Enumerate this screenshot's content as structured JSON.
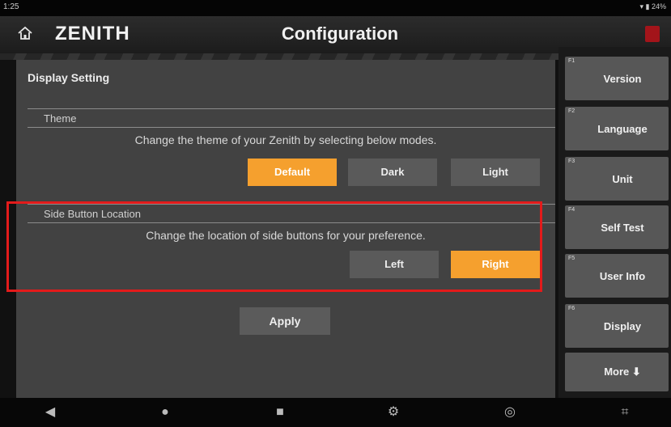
{
  "status_bar": {
    "time": "1:25",
    "right": "▾ ▮ 24%"
  },
  "header": {
    "logo": "ZENITH",
    "title": "Configuration"
  },
  "display_setting": {
    "title": "Display Setting",
    "theme": {
      "header": "Theme",
      "description": "Change the theme of your Zenith by selecting below modes.",
      "options": [
        "Default",
        "Dark",
        "Light"
      ],
      "selected": "Default"
    },
    "side_button": {
      "header": "Side Button Location",
      "description": "Change the location of side buttons for your preference.",
      "options": [
        "Left",
        "Right"
      ],
      "selected": "Right"
    },
    "apply_label": "Apply"
  },
  "side_keys": [
    {
      "num": "F1",
      "label": "Version"
    },
    {
      "num": "F2",
      "label": "Language"
    },
    {
      "num": "F3",
      "label": "Unit"
    },
    {
      "num": "F4",
      "label": "Self Test"
    },
    {
      "num": "F5",
      "label": "User Info"
    },
    {
      "num": "F6",
      "label": "Display"
    },
    {
      "num": "",
      "label": "More ⬇"
    }
  ],
  "nav_bar": {
    "back": "◀",
    "home": "●",
    "recents": "■",
    "settings": "⚙",
    "circle": "◎",
    "screenshot": "⌗"
  },
  "colors": {
    "accent": "#f5a02e",
    "highlight_box": "#e31b1b",
    "panel": "#424242",
    "button": "#5a5a5a"
  }
}
